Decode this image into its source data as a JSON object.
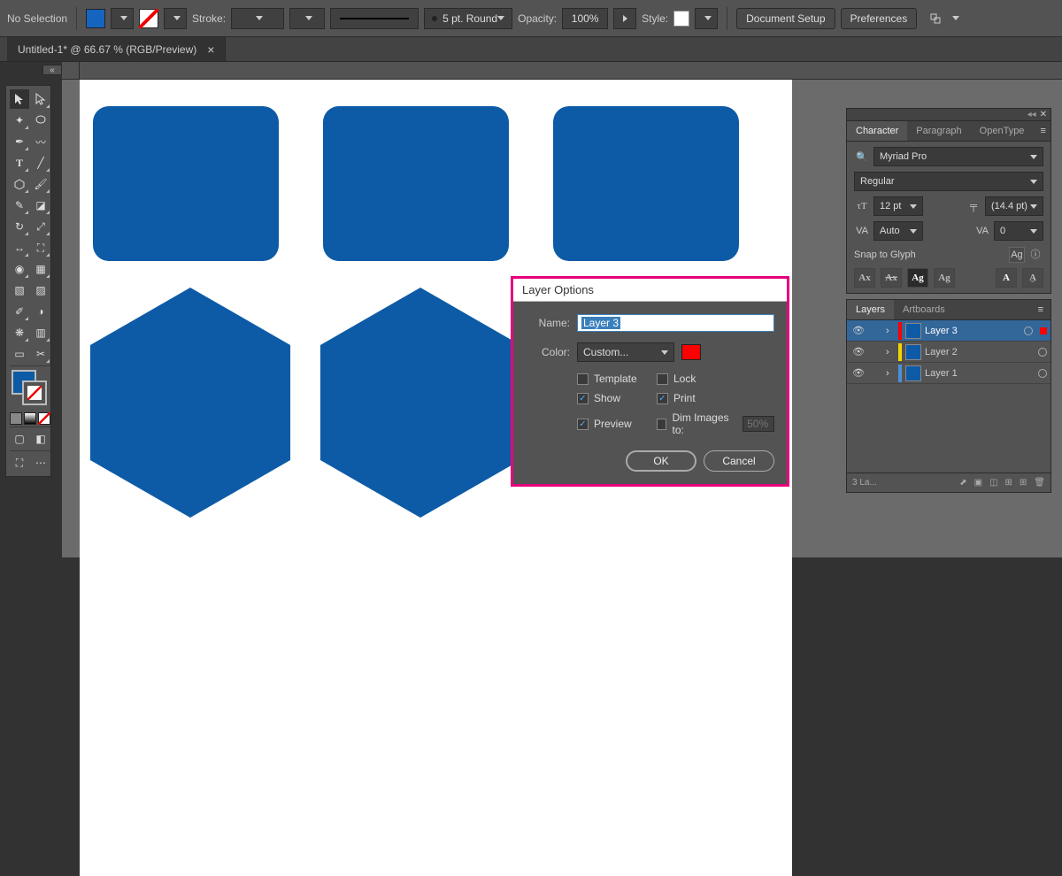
{
  "options_bar": {
    "no_selection": "No Selection",
    "stroke_label": "Stroke:",
    "brush_dd": "5 pt. Round",
    "opacity_label": "Opacity:",
    "opacity_value": "100%",
    "style_label": "Style:",
    "doc_setup": "Document Setup",
    "prefs": "Preferences"
  },
  "tab": {
    "title": "Untitled-1* @ 66.67 % (RGB/Preview)",
    "close": "×"
  },
  "dialog": {
    "title": "Layer Options",
    "name_label": "Name:",
    "name_value": "Layer 3",
    "color_label": "Color:",
    "color_value": "Custom...",
    "template": "Template",
    "lock": "Lock",
    "show": "Show",
    "print": "Print",
    "preview": "Preview",
    "dim": "Dim Images to:",
    "dim_value": "50%",
    "ok": "OK",
    "cancel": "Cancel"
  },
  "char_panel": {
    "tab_character": "Character",
    "tab_paragraph": "Paragraph",
    "tab_opentype": "OpenType",
    "font": "Myriad Pro",
    "style": "Regular",
    "size": "12 pt",
    "leading": "(14.4 pt)",
    "kerning": "Auto",
    "tracking": "0",
    "snap": "Snap to Glyph"
  },
  "layers_panel": {
    "tab_layers": "Layers",
    "tab_artboards": "Artboards",
    "layers": [
      {
        "name": "Layer 3",
        "color": "#ff0000"
      },
      {
        "name": "Layer 2",
        "color": "#f2d600"
      },
      {
        "name": "Layer 1",
        "color": "#4a90d9"
      }
    ],
    "footer": "3 La..."
  }
}
